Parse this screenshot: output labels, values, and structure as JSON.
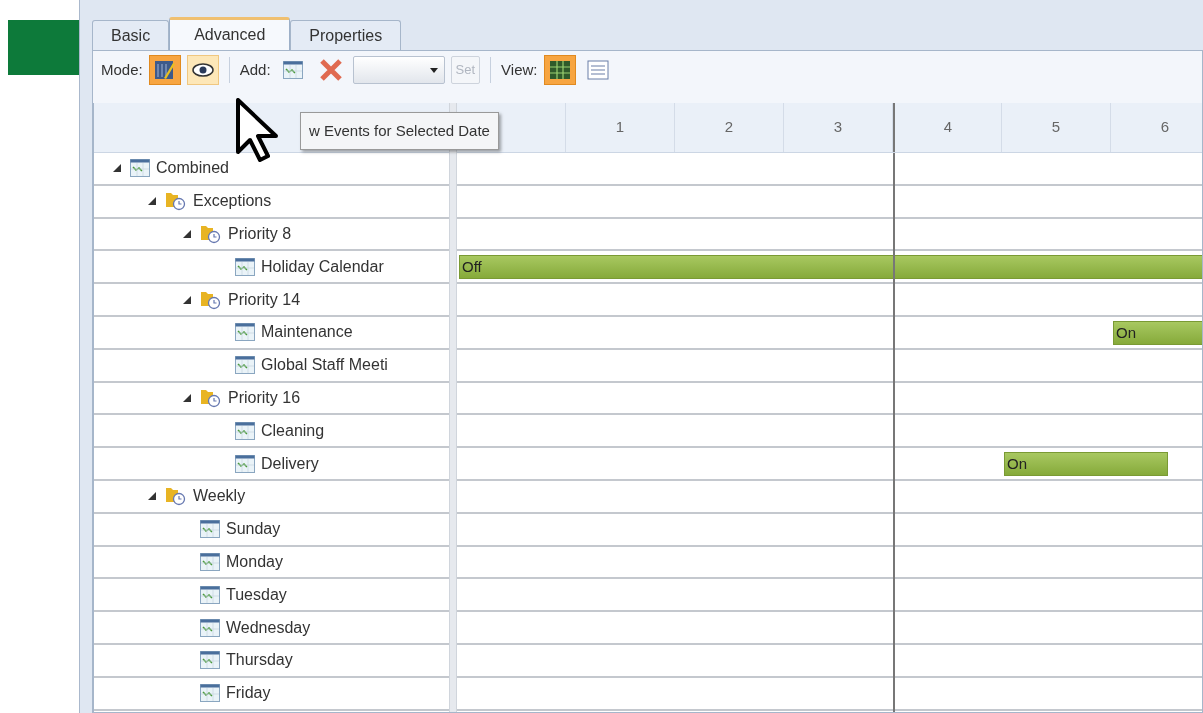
{
  "tabs": [
    {
      "label": "Basic",
      "selected": false
    },
    {
      "label": "Advanced",
      "selected": true
    },
    {
      "label": "Properties",
      "selected": false
    }
  ],
  "toolbar": {
    "mode_label": "Mode:",
    "mode_buttons": [
      {
        "kind": "edit",
        "selected": true
      },
      {
        "kind": "view",
        "selected": false
      }
    ],
    "add_label": "Add:",
    "set_button": {
      "label": "Set",
      "disabled": true
    },
    "view_label": "View:",
    "view_buttons": [
      {
        "kind": "grid",
        "selected": true
      },
      {
        "kind": "list",
        "selected": false
      }
    ]
  },
  "tooltip": "w Events for Selected Date",
  "columns": [
    {
      "label": "1",
      "week_start": false
    },
    {
      "label": "2",
      "week_start": false
    },
    {
      "label": "3",
      "week_start": false
    },
    {
      "label": "4",
      "week_start": true
    },
    {
      "label": "5",
      "week_start": false
    },
    {
      "label": "6",
      "week_start": false
    }
  ],
  "tree": [
    {
      "label": "Combined",
      "kind": "calendar",
      "expanded": true,
      "children": [
        {
          "label": "Exceptions",
          "kind": "group",
          "expanded": true,
          "children": [
            {
              "label": "Priority 8",
              "kind": "group",
              "expanded": true,
              "children": [
                {
                  "label": "Holiday Calendar",
                  "kind": "calendar",
                  "events": [
                    {
                      "label": "Off"
                    }
                  ]
                }
              ]
            },
            {
              "label": "Priority 14",
              "kind": "group",
              "expanded": true,
              "children": [
                {
                  "label": "Maintenance",
                  "kind": "calendar",
                  "events": [
                    {
                      "label": "On"
                    }
                  ]
                },
                {
                  "label": "Global Staff Meeti",
                  "kind": "calendar"
                }
              ]
            },
            {
              "label": "Priority 16",
              "kind": "group",
              "expanded": true,
              "children": [
                {
                  "label": "Cleaning",
                  "kind": "calendar"
                },
                {
                  "label": "Delivery",
                  "kind": "calendar",
                  "events": [
                    {
                      "label": "On"
                    }
                  ]
                }
              ]
            }
          ]
        },
        {
          "label": "Weekly",
          "kind": "group",
          "expanded": true,
          "children": [
            {
              "label": "Sunday",
              "kind": "calendar"
            },
            {
              "label": "Monday",
              "kind": "calendar"
            },
            {
              "label": "Tuesday",
              "kind": "calendar"
            },
            {
              "label": "Wednesday",
              "kind": "calendar"
            },
            {
              "label": "Thursday",
              "kind": "calendar"
            },
            {
              "label": "Friday",
              "kind": "calendar"
            }
          ]
        }
      ]
    }
  ]
}
